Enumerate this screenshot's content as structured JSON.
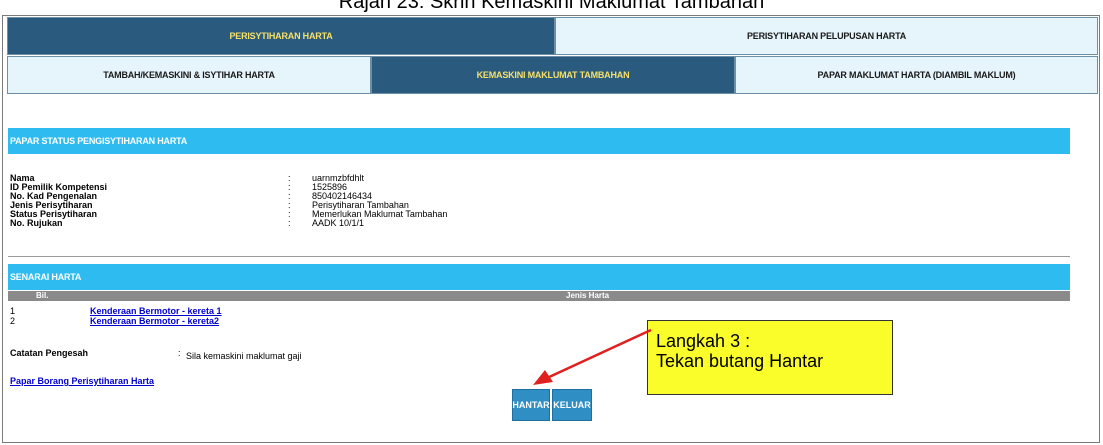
{
  "caption": "Rajah 23: Skrin Kemaskini Maklumat Tambahan",
  "tabs_top": [
    {
      "label": "PERISYTIHARAN HARTA",
      "active": true
    },
    {
      "label": "PERISYTIHARAN PELUPUSAN HARTA",
      "active": false
    }
  ],
  "tabs_sub": [
    {
      "label": "TAMBAH/KEMASKINI & ISYTIHAR HARTA",
      "active": false
    },
    {
      "label": "KEMASKINI MAKLUMAT TAMBAHAN",
      "active": true
    },
    {
      "label": "PAPAR MAKLUMAT HARTA (DIAMBIL MAKLUM)",
      "active": false
    }
  ],
  "status_section": {
    "title": "PAPAR STATUS PENGISYTIHARAN HARTA",
    "fields": [
      {
        "label": "Nama",
        "value": "uarnmzbfdhlt"
      },
      {
        "label": "ID Pemilik Kompetensi",
        "value": "1525896"
      },
      {
        "label": "No. Kad Pengenalan",
        "value": "850402146434"
      },
      {
        "label": "Jenis Perisytiharan",
        "value": "Perisytiharan Tambahan"
      },
      {
        "label": "Status Perisytiharan",
        "value": "Memerlukan Maklumat Tambahan"
      },
      {
        "label": "No. Rujukan",
        "value": "AADK 10/1/1"
      }
    ],
    "colon": ":"
  },
  "asset_section": {
    "title": "SENARAI HARTA",
    "columns": {
      "bil": "Bil.",
      "jenis": "Jenis Harta"
    },
    "rows": [
      {
        "num": "1",
        "label": "Kenderaan Bermotor - kereta 1"
      },
      {
        "num": "2",
        "label": "Kenderaan Bermotor - kereta2"
      }
    ]
  },
  "note": {
    "label": "Catatan Pengesah",
    "colon": ":",
    "value": "Sila kemaskini maklumat gaji"
  },
  "form_link": "Papar Borang Perisytiharan Harta",
  "buttons": {
    "submit": "HANTAR",
    "exit": "KELUAR"
  },
  "callout": {
    "line1": "Langkah 3 :",
    "line2": "Tekan butang Hantar"
  },
  "colors": {
    "accent": "#2ebcf0",
    "active_tab": "#2a5a7e",
    "callout_bg": "#fafd2a",
    "arrow": "#e0201e"
  }
}
